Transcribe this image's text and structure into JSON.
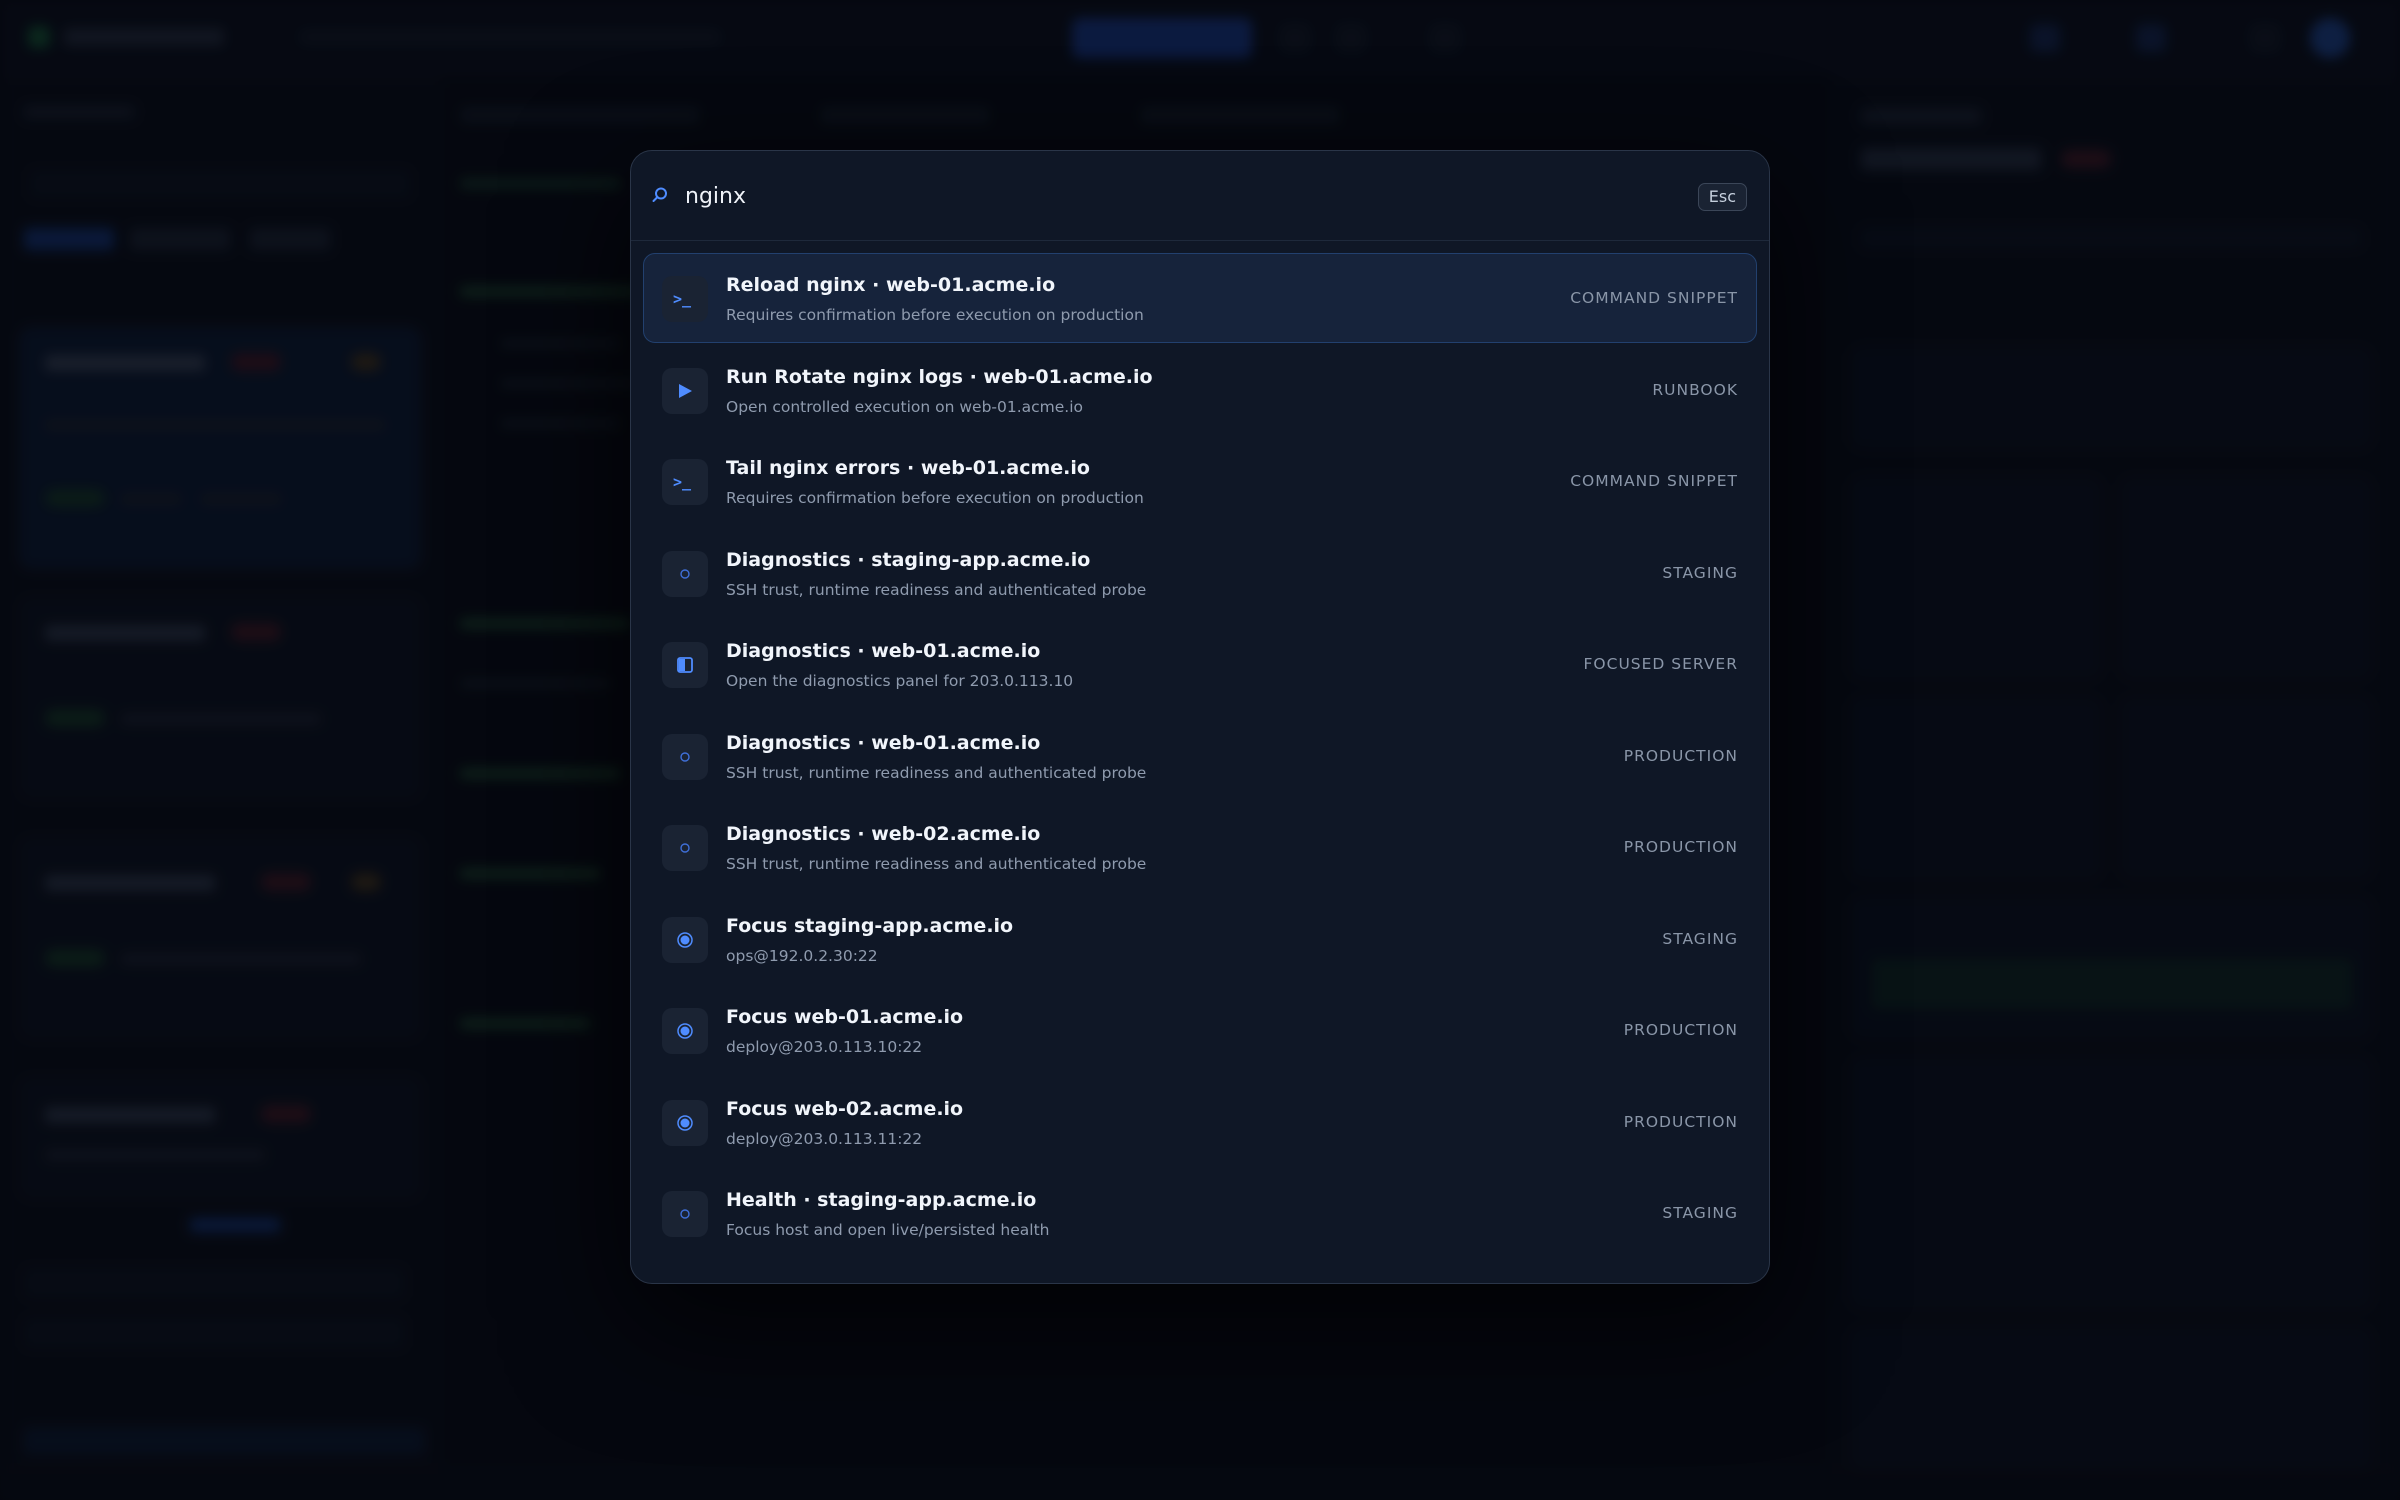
{
  "search": {
    "query": "nginx",
    "esc_label": "Esc"
  },
  "colors": {
    "accent": "#4f8cff",
    "palette_bg": "#0f1726",
    "selected_bg": "#16233b"
  },
  "results": [
    {
      "icon": "terminal-icon",
      "title": "Reload nginx · web-01.acme.io",
      "subtitle": "Requires confirmation before execution on production",
      "tag": "COMMAND SNIPPET",
      "selected": true
    },
    {
      "icon": "play-icon",
      "title": "Run Rotate nginx logs · web-01.acme.io",
      "subtitle": "Open controlled execution on web-01.acme.io",
      "tag": "RUNBOOK",
      "selected": false
    },
    {
      "icon": "terminal-icon",
      "title": "Tail nginx errors · web-01.acme.io",
      "subtitle": "Requires confirmation before execution on production",
      "tag": "COMMAND SNIPPET",
      "selected": false
    },
    {
      "icon": "circle-outline-icon",
      "title": "Diagnostics · staging-app.acme.io",
      "subtitle": "SSH trust, runtime readiness and authenticated probe",
      "tag": "STAGING",
      "selected": false
    },
    {
      "icon": "panel-icon",
      "title": "Diagnostics · web-01.acme.io",
      "subtitle": "Open the diagnostics panel for 203.0.113.10",
      "tag": "FOCUSED SERVER",
      "selected": false
    },
    {
      "icon": "circle-outline-icon",
      "title": "Diagnostics · web-01.acme.io",
      "subtitle": "SSH trust, runtime readiness and authenticated probe",
      "tag": "PRODUCTION",
      "selected": false
    },
    {
      "icon": "circle-outline-icon",
      "title": "Diagnostics · web-02.acme.io",
      "subtitle": "SSH trust, runtime readiness and authenticated probe",
      "tag": "PRODUCTION",
      "selected": false
    },
    {
      "icon": "target-icon",
      "title": "Focus staging-app.acme.io",
      "subtitle": "ops@192.0.2.30:22",
      "tag": "STAGING",
      "selected": false
    },
    {
      "icon": "target-icon",
      "title": "Focus web-01.acme.io",
      "subtitle": "deploy@203.0.113.10:22",
      "tag": "PRODUCTION",
      "selected": false
    },
    {
      "icon": "target-icon",
      "title": "Focus web-02.acme.io",
      "subtitle": "deploy@203.0.113.11:22",
      "tag": "PRODUCTION",
      "selected": false
    },
    {
      "icon": "circle-outline-icon",
      "title": "Health · staging-app.acme.io",
      "subtitle": "Focus host and open live/persisted health",
      "tag": "STAGING",
      "selected": false
    }
  ]
}
